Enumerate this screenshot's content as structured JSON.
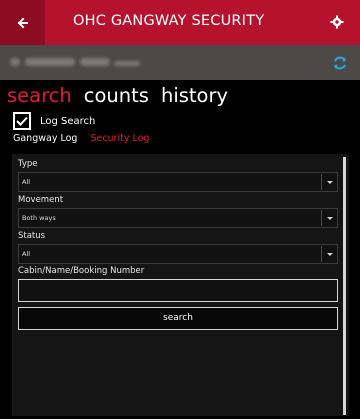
{
  "header": {
    "title": "OHC GANGWAY SECURITY",
    "back_icon": "back-arrow-icon",
    "settings_icon": "gear-icon"
  },
  "subbar": {
    "refresh_icon": "refresh-icon"
  },
  "pivots": [
    {
      "label": "search",
      "active": true
    },
    {
      "label": "counts",
      "active": false
    },
    {
      "label": "history",
      "active": false
    }
  ],
  "log_search": {
    "label": "Log Search",
    "checked": true
  },
  "log_tabs": [
    {
      "label": "Gangway Log",
      "active": false
    },
    {
      "label": "Security Log",
      "active": true
    }
  ],
  "form": {
    "type": {
      "label": "Type",
      "value": "All"
    },
    "movement": {
      "label": "Movement",
      "value": "Both ways"
    },
    "status": {
      "label": "Status",
      "value": "All"
    },
    "query": {
      "label": "Cabin/Name/Booking Number",
      "value": ""
    },
    "search_label": "search"
  },
  "colors": {
    "accent": "#b5122e",
    "active_text": "#e41c32",
    "subbar": "#4c4a48"
  }
}
